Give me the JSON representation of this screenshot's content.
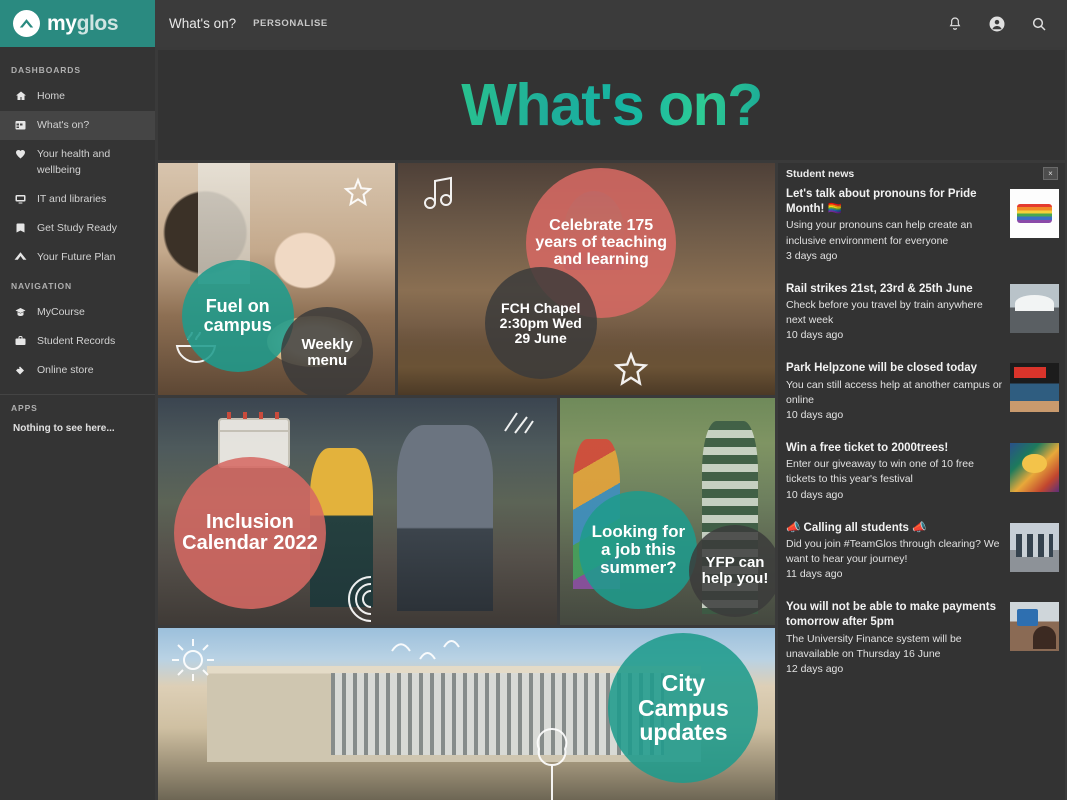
{
  "brand": {
    "my": "my",
    "glos": "glos",
    "logo_icon": "mountain-chevron-logo"
  },
  "topbar": {
    "page_title": "What's on?",
    "personalise": "PERSONALISE",
    "icons": [
      {
        "name": "notifications-bell-icon",
        "glyph": "bell"
      },
      {
        "name": "user-account-icon",
        "glyph": "user"
      },
      {
        "name": "search-icon",
        "glyph": "search"
      }
    ]
  },
  "sidebar": {
    "dashboards_heading": "DASHBOARDS",
    "dashboards": [
      {
        "label": "Home",
        "icon": "home-icon",
        "active": false
      },
      {
        "label": "What's on?",
        "icon": "calendar-icon",
        "active": true
      },
      {
        "label": "Your health and wellbeing",
        "icon": "heart-icon",
        "active": false
      },
      {
        "label": "IT and libraries",
        "icon": "monitor-icon",
        "active": false
      },
      {
        "label": "Get Study Ready",
        "icon": "book-icon",
        "active": false
      },
      {
        "label": "Your Future Plan",
        "icon": "chevron-up-icon",
        "active": false
      }
    ],
    "navigation_heading": "NAVIGATION",
    "navigation": [
      {
        "label": "MyCourse",
        "icon": "graduation-cap-icon"
      },
      {
        "label": "Student Records",
        "icon": "briefcase-icon"
      },
      {
        "label": "Online store",
        "icon": "tag-icon"
      }
    ],
    "apps_heading": "APPS",
    "apps_empty": "Nothing to see here..."
  },
  "hero": {
    "title": "What's on?"
  },
  "tiles": [
    {
      "name": "fuel-on-campus",
      "badges": [
        {
          "text": "Fuel on campus",
          "style": "teal"
        },
        {
          "text": "Weekly menu",
          "style": "dark"
        }
      ]
    },
    {
      "name": "celebrate-175-years",
      "badges": [
        {
          "text": "Celebrate 175 years of teaching and learning",
          "style": "red"
        },
        {
          "text": "FCH Chapel 2:30pm Wed 29 June",
          "style": "dark"
        }
      ]
    },
    {
      "name": "inclusion-calendar",
      "badges": [
        {
          "text": "Inclusion Calendar 2022",
          "style": "red"
        }
      ]
    },
    {
      "name": "summer-jobs",
      "badges": [
        {
          "text": "Looking for a job this summer?",
          "style": "teal"
        },
        {
          "text": "YFP can help you!",
          "style": "dark"
        }
      ]
    },
    {
      "name": "city-campus-updates",
      "badges": [
        {
          "text": "City Campus updates",
          "style": "teal"
        }
      ]
    }
  ],
  "tile_text": {
    "fuel_main": "Fuel on campus",
    "fuel_sub": "Weekly menu",
    "celebrate_main": "Celebrate 175 years of teaching and learning",
    "celebrate_sub": "FCH Chapel 2:30pm Wed 29 June",
    "inclusion_main": "Inclusion Calendar 2022",
    "jobs_main": "Looking for a job this summer?",
    "jobs_sub": "YFP can help you!",
    "city_main": "City Campus updates"
  },
  "news": {
    "title": "Student news",
    "close_label": "×",
    "items": [
      {
        "title": "Let's talk about pronouns for Pride Month! 🏳️‍🌈",
        "summary": "Using your pronouns can help create an inclusive environment for everyone",
        "time": "3 days ago",
        "thumb": "th-pride"
      },
      {
        "title": "Rail strikes 21st, 23rd & 25th June",
        "summary": "Check before you travel by train anywhere next week",
        "time": "10 days ago",
        "thumb": "th-rail"
      },
      {
        "title": "Park Helpzone will be closed today",
        "summary": "You can still access help at another campus or online",
        "time": "10 days ago",
        "thumb": "th-park"
      },
      {
        "title": "Win a free ticket to 2000trees!",
        "summary": "Enter our giveaway to win one of 10 free tickets to this year's festival",
        "time": "10 days ago",
        "thumb": "th-trees"
      },
      {
        "title": "📣 Calling all students 📣",
        "summary": "Did you join #TeamGlos through clearing? We want to hear your journey!",
        "time": "11 days ago",
        "thumb": "th-calling"
      },
      {
        "title": "You will not be able to make payments tomorrow after 5pm",
        "summary": "The University Finance system will be unavailable on Thursday 16 June",
        "time": "12 days ago",
        "thumb": "th-pay"
      }
    ]
  },
  "colors": {
    "brand_teal": "#2a8a80",
    "badge_teal": "#1f9b8c",
    "badge_red": "#d66863",
    "panel_dark": "#333333",
    "app_bg": "#3a3a3a",
    "sidebar_bg": "#343434"
  }
}
